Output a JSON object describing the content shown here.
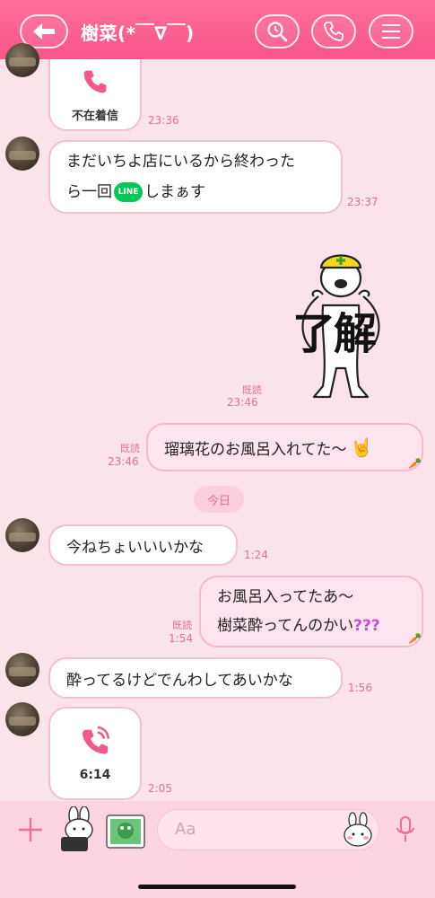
{
  "header": {
    "title": "樹菜(*￣∇￣)",
    "back_icon": "back-arrow-icon",
    "search_icon": "search-icon",
    "call_icon": "phone-icon",
    "menu_icon": "hamburger-menu-icon"
  },
  "messages": {
    "m1": {
      "label": "不在着信",
      "time": "23:36"
    },
    "m2": {
      "line1": "まだいちよ店にいるから終わった",
      "line2_pre": "ら一回",
      "badge": "LINE",
      "line2_post": "しまぁす",
      "time": "23:37"
    },
    "m3": {
      "sticker_text": "了解",
      "read": "既読",
      "time": "23:46"
    },
    "m4": {
      "text": "瑠璃花のお風呂入れてた〜",
      "emoji": "🤘",
      "read": "既読",
      "time": "23:46"
    },
    "date": "今日",
    "m5": {
      "text": "今ねちょいいいかな",
      "time": "1:24"
    },
    "m6": {
      "line1": "お風呂入ってたあ〜",
      "line2": "樹菜酔ってんのかい",
      "emoji": "???",
      "read": "既読",
      "time": "1:54"
    },
    "m7": {
      "text": "酔ってるけどでんわしてあいかな",
      "time": "1:56"
    },
    "m8": {
      "label": "6:14",
      "time": "2:05"
    }
  },
  "footer": {
    "placeholder": "Aa",
    "plus_icon": "plus-icon",
    "sticker_icon": "sticker-icon",
    "photo_icon": "photo-icon",
    "emoji_icon": "emoji-icon",
    "mic_icon": "microphone-icon"
  },
  "colors": {
    "header": "#f7558a",
    "background": "#fbe3ea",
    "accent": "#e2709a"
  }
}
